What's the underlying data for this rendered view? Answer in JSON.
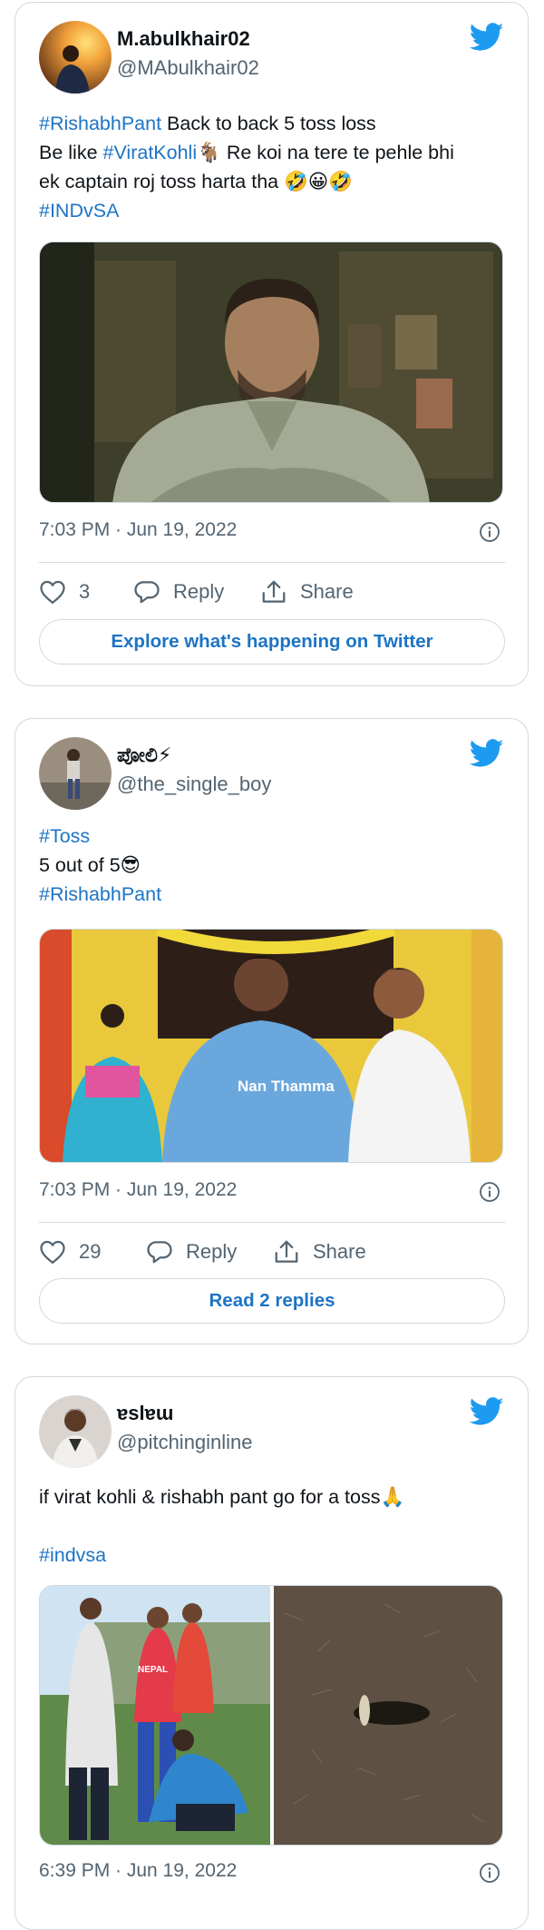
{
  "tweets": [
    {
      "display_name": "M.abulkhair02",
      "handle": "@MAbulkhair02",
      "text_lines": [
        [
          {
            "t": "#RishabhPant",
            "tag": true
          },
          {
            "t": " Back to back 5 toss loss",
            "tag": false
          }
        ],
        [
          {
            "t": "Be like ",
            "tag": false
          },
          {
            "t": "#ViratKohli",
            "tag": true
          },
          {
            "t": "🐐 Re koi na tere te pehle bhi",
            "tag": false
          }
        ],
        [
          {
            "t": "ek captain roj toss harta tha 🤣😀🤣",
            "tag": false
          }
        ],
        [
          {
            "t": "#INDvSA",
            "tag": true
          }
        ]
      ],
      "timestamp": "7:03 PM · Jun 19, 2022",
      "like_count": "3",
      "reply_label": "Reply",
      "share_label": "Share",
      "footer_button": "Explore what's happening on Twitter"
    },
    {
      "display_name": "ಪೋಲಿ⚡",
      "handle": "@the_single_boy",
      "text_lines": [
        [
          {
            "t": "#Toss",
            "tag": true
          }
        ],
        [
          {
            "t": "5 out of 5😎",
            "tag": false
          }
        ],
        [
          {
            "t": "#RishabhPant",
            "tag": true
          }
        ]
      ],
      "media_caption": "Nan Thamma",
      "timestamp": "7:03 PM · Jun 19, 2022",
      "like_count": "29",
      "reply_label": "Reply",
      "share_label": "Share",
      "footer_button": "Read 2 replies"
    },
    {
      "display_name": "ɐslɐɯ",
      "handle": "@pitchinginline",
      "text_lines": [
        [
          {
            "t": "if virat kohli & rishabh pant go for a toss🙏",
            "tag": false
          }
        ],
        [
          {
            "t": "",
            "tag": false
          }
        ],
        [
          {
            "t": "#indvsa",
            "tag": true
          }
        ]
      ],
      "media_jersey_text": "NEPAL",
      "timestamp": "6:39 PM · Jun 19, 2022"
    }
  ],
  "colors": {
    "hashtag": "#1d74c5",
    "twitter_blue": "#1d9bf0",
    "secondary_text": "#536471",
    "border": "#cfd9de"
  },
  "icons": [
    "twitter-bird-icon",
    "info-icon",
    "heart-icon",
    "reply-bubble-icon",
    "share-icon"
  ]
}
